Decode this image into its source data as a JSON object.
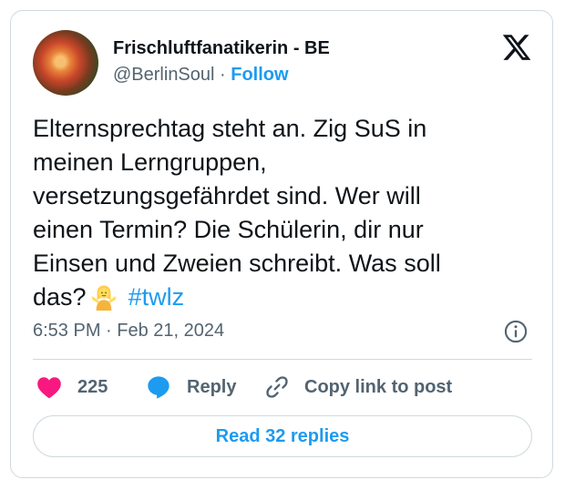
{
  "author": {
    "display_name": "Frischluftfanatikerin - BE",
    "handle": "@BerlinSoul",
    "separator": " · ",
    "follow_label": "Follow"
  },
  "tweet": {
    "lines": [
      "Elternsprechtag steht an. Zig SuS in",
      "meinen Lerngruppen,",
      "versetzungsgefährdet sind. Wer will",
      "einen Termin? Die Schülerin, dir nur",
      "Einsen und Zweien schreibt. Was soll"
    ],
    "last_line_text": "das?",
    "emoji": "person-shrugging-emoji",
    "hashtag": "#twlz"
  },
  "meta": {
    "timestamp": "6:53 PM · Feb 21, 2024"
  },
  "actions": {
    "like_count": "225",
    "reply_label": "Reply",
    "copy_label": "Copy link to post"
  },
  "read_replies_label": "Read 32 replies",
  "colors": {
    "accent": "#1d9bf0",
    "like": "#f91880",
    "text": "#0f1419",
    "muted": "#536471",
    "border": "#cfd9de"
  },
  "icons": [
    "x-logo-icon",
    "info-icon",
    "heart-icon",
    "reply-bubble-icon",
    "link-icon"
  ]
}
